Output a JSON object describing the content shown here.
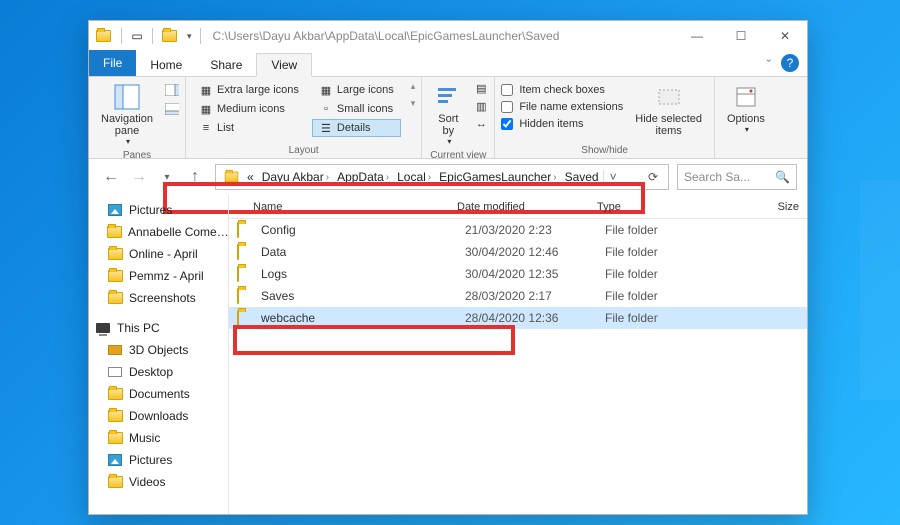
{
  "title_path": "C:\\Users\\Dayu Akbar\\AppData\\Local\\EpicGamesLauncher\\Saved",
  "tabs": {
    "file": "File",
    "home": "Home",
    "share": "Share",
    "view": "View"
  },
  "ribbon": {
    "panes": {
      "navpane": "Navigation\npane",
      "group": "Panes"
    },
    "layout": {
      "xl": "Extra large icons",
      "lg": "Large icons",
      "md": "Medium icons",
      "sm": "Small icons",
      "list": "List",
      "details": "Details",
      "group": "Layout"
    },
    "currentview": {
      "sortby": "Sort\nby",
      "group": "Current view"
    },
    "showhide": {
      "checkboxes": "Item check boxes",
      "ext": "File name extensions",
      "hidden": "Hidden items",
      "hidesel": "Hide selected\nitems",
      "group": "Show/hide"
    },
    "options": "Options"
  },
  "breadcrumb": [
    "Dayu Akbar",
    "AppData",
    "Local",
    "EpicGamesLauncher",
    "Saved"
  ],
  "breadcrumb_prefix": "«",
  "search_placeholder": "Search Sa...",
  "sidebar": {
    "quick": [
      {
        "label": "Pictures",
        "icon": "pic"
      },
      {
        "label": "Annabelle Come…",
        "icon": "folder"
      },
      {
        "label": "Online - April",
        "icon": "folder"
      },
      {
        "label": "Pemmz - April",
        "icon": "folder"
      },
      {
        "label": "Screenshots",
        "icon": "folder"
      }
    ],
    "thispc_label": "This PC",
    "thispc": [
      {
        "label": "3D Objects",
        "icon": "box"
      },
      {
        "label": "Desktop",
        "icon": "scrn"
      },
      {
        "label": "Documents",
        "icon": "folder"
      },
      {
        "label": "Downloads",
        "icon": "folder"
      },
      {
        "label": "Music",
        "icon": "folder"
      },
      {
        "label": "Pictures",
        "icon": "pic"
      },
      {
        "label": "Videos",
        "icon": "folder"
      }
    ]
  },
  "columns": {
    "name": "Name",
    "date": "Date modified",
    "type": "Type",
    "size": "Size"
  },
  "rows": [
    {
      "name": "Config",
      "date": "21/03/2020 2:23",
      "type": "File folder"
    },
    {
      "name": "Data",
      "date": "30/04/2020 12:46",
      "type": "File folder"
    },
    {
      "name": "Logs",
      "date": "30/04/2020 12:35",
      "type": "File folder"
    },
    {
      "name": "Saves",
      "date": "28/03/2020 2:17",
      "type": "File folder"
    },
    {
      "name": "webcache",
      "date": "28/04/2020 12:36",
      "type": "File folder",
      "selected": true
    }
  ]
}
